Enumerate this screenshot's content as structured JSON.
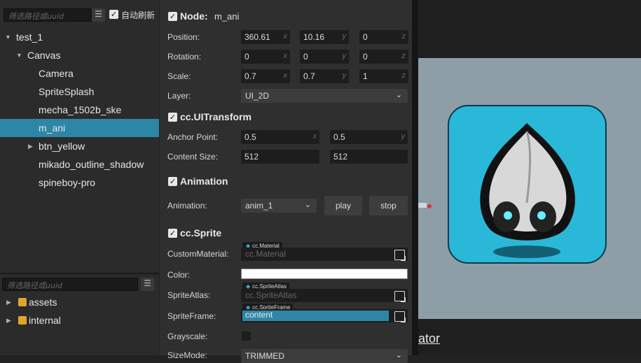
{
  "hierarchy": {
    "filter_placeholder": "筛选路径或uuid",
    "auto_refresh_label": "自动刷新",
    "items": [
      {
        "label": "test_1",
        "arrow": "▼"
      },
      {
        "label": "Canvas",
        "arrow": "▼"
      },
      {
        "label": "Camera"
      },
      {
        "label": "SpriteSplash"
      },
      {
        "label": "mecha_1502b_ske"
      },
      {
        "label": "m_ani"
      },
      {
        "label": "btn_yellow",
        "arrow": "▶"
      },
      {
        "label": "mikado_outline_shadow"
      },
      {
        "label": "spineboy-pro"
      }
    ]
  },
  "assets": {
    "filter_placeholder": "筛选路径或uuid",
    "items": [
      {
        "label": "assets",
        "arrow": "▶"
      },
      {
        "label": "internal",
        "arrow": "▶"
      }
    ]
  },
  "inspector": {
    "node": {
      "title": "Node:",
      "name": "m_ani",
      "position_label": "Position:",
      "position": [
        "360.61",
        "10.16",
        "0"
      ],
      "rotation_label": "Rotation:",
      "rotation": [
        "0",
        "0",
        "0"
      ],
      "scale_label": "Scale:",
      "scale": [
        "0.7",
        "0.7",
        "1"
      ],
      "layer_label": "Layer:",
      "layer_value": "UI_2D",
      "axes": [
        "x",
        "y",
        "z"
      ]
    },
    "uitransform": {
      "title": "cc.UITransform",
      "anchor_label": "Anchor Point:",
      "anchor": [
        "0.5",
        "0.5"
      ],
      "content_size_label": "Content Size:",
      "content_size": [
        "512",
        "512"
      ]
    },
    "animation": {
      "title": "Animation",
      "label": "Animation:",
      "value": "anim_1",
      "play_label": "play",
      "stop_label": "stop"
    },
    "sprite": {
      "title": "cc.Sprite",
      "custom_material_label": "CustomMaterial:",
      "custom_material_tag": "cc.Material",
      "custom_material_value": "cc.Material",
      "color_label": "Color:",
      "sprite_atlas_label": "SpriteAtlas:",
      "sprite_atlas_tag": "cc.SpriteAtlas",
      "sprite_atlas_value": "cc.SpriteAtlas",
      "sprite_frame_label": "SpriteFrame:",
      "sprite_frame_tag": "cc.SpriteFrame",
      "sprite_frame_value": "content",
      "grayscale_label": "Grayscale:",
      "size_mode_label": "SizeMode:",
      "size_mode_value": "TRIMMED"
    }
  },
  "scene": {
    "link_text": "ator"
  },
  "colors": {
    "selection": "#2e86a6",
    "accent": "#3aa5d8",
    "logo_bg": "#2ab8d8"
  }
}
